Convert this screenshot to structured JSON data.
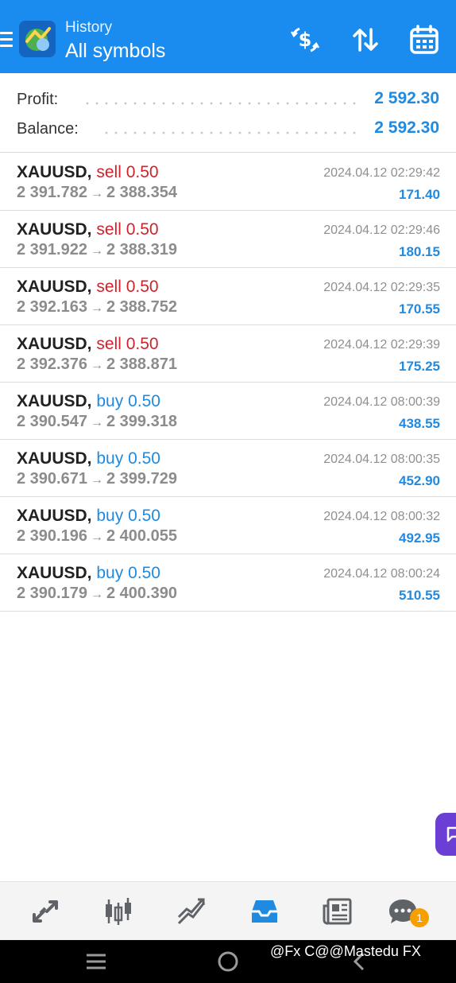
{
  "header": {
    "subtitle": "History",
    "title": "All symbols",
    "colors": {
      "background": "#1a8cf0",
      "text": "#ffffff"
    },
    "icons": [
      "menu-icon",
      "app-logo",
      "currency-exchange-icon",
      "sort-icon",
      "calendar-icon"
    ]
  },
  "summary": {
    "profit_label": "Profit:",
    "profit_value": "2 592.30",
    "balance_label": "Balance:",
    "balance_value": "2 592.30"
  },
  "deals": [
    {
      "symbol": "XAUUSD,",
      "side": "sell",
      "volume": "0.50",
      "open": "2 391.782",
      "arrow": "→",
      "close": "2 388.354",
      "time": "2024.04.12 02:29:42",
      "profit": "171.40"
    },
    {
      "symbol": "XAUUSD,",
      "side": "sell",
      "volume": "0.50",
      "open": "2 391.922",
      "arrow": "→",
      "close": "2 388.319",
      "time": "2024.04.12 02:29:46",
      "profit": "180.15"
    },
    {
      "symbol": "XAUUSD,",
      "side": "sell",
      "volume": "0.50",
      "open": "2 392.163",
      "arrow": "→",
      "close": "2 388.752",
      "time": "2024.04.12 02:29:35",
      "profit": "170.55"
    },
    {
      "symbol": "XAUUSD,",
      "side": "sell",
      "volume": "0.50",
      "open": "2 392.376",
      "arrow": "→",
      "close": "2 388.871",
      "time": "2024.04.12 02:29:39",
      "profit": "175.25"
    },
    {
      "symbol": "XAUUSD,",
      "side": "buy",
      "volume": "0.50",
      "open": "2 390.547",
      "arrow": "→",
      "close": "2 399.318",
      "time": "2024.04.12 08:00:39",
      "profit": "438.55"
    },
    {
      "symbol": "XAUUSD,",
      "side": "buy",
      "volume": "0.50",
      "open": "2 390.671",
      "arrow": "→",
      "close": "2 399.729",
      "time": "2024.04.12 08:00:35",
      "profit": "452.90"
    },
    {
      "symbol": "XAUUSD,",
      "side": "buy",
      "volume": "0.50",
      "open": "2 390.196",
      "arrow": "→",
      "close": "2 400.055",
      "time": "2024.04.12 08:00:32",
      "profit": "492.95"
    },
    {
      "symbol": "XAUUSD,",
      "side": "buy",
      "volume": "0.50",
      "open": "2 390.179",
      "arrow": "→",
      "close": "2 400.390",
      "time": "2024.04.12 08:00:24",
      "profit": "510.55"
    }
  ],
  "colors": {
    "sell": "#d0222c",
    "buy": "#1f8ae0",
    "profit": "#1f8ae0",
    "chat_fab": "#6c3fd4",
    "badge": "#f5a000"
  },
  "tabs": [
    {
      "name": "quotes",
      "icon": "quotes-arrows-icon"
    },
    {
      "name": "chart",
      "icon": "candlestick-chart-icon"
    },
    {
      "name": "trade",
      "icon": "trade-lines-icon"
    },
    {
      "name": "history",
      "icon": "inbox-tray-icon",
      "active": true
    },
    {
      "name": "news",
      "icon": "newspaper-icon"
    },
    {
      "name": "messages",
      "icon": "chat-bubble-icon"
    }
  ],
  "badge": {
    "count": "1"
  },
  "system_nav": {
    "icons": [
      "recents-icon",
      "home-icon",
      "back-icon"
    ]
  },
  "watermark": {
    "text": "@Fx C@@Mastedu FX"
  }
}
